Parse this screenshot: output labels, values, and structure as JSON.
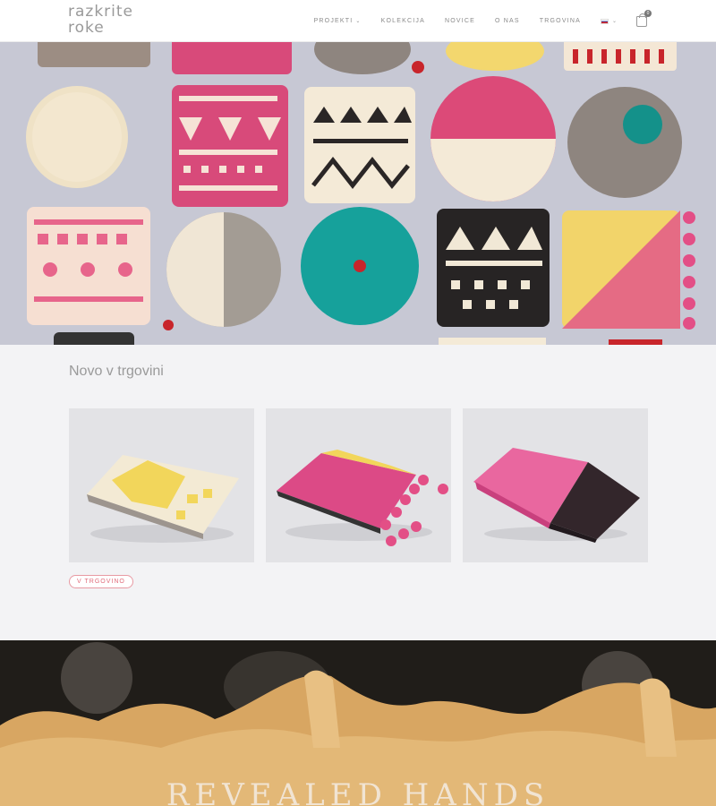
{
  "header": {
    "logo_line1": "razkrite",
    "logo_line2": "roke",
    "nav": {
      "projekti": "PROJEKTI",
      "kolekcija": "KOLEKCIJA",
      "novice": "NOVICE",
      "o_nas": "O NAS",
      "trgovina": "TRGOVINA"
    },
    "cart_count": "0"
  },
  "section": {
    "title": "Novo v trgovini",
    "button_label": "V TRGOVINO"
  },
  "banner": {
    "title": "REVEALED HANDS"
  },
  "colors": {
    "accent_pink": "#e06b7a",
    "hero_background": "#c7c8d4",
    "banner_background": "#1f1c18"
  }
}
